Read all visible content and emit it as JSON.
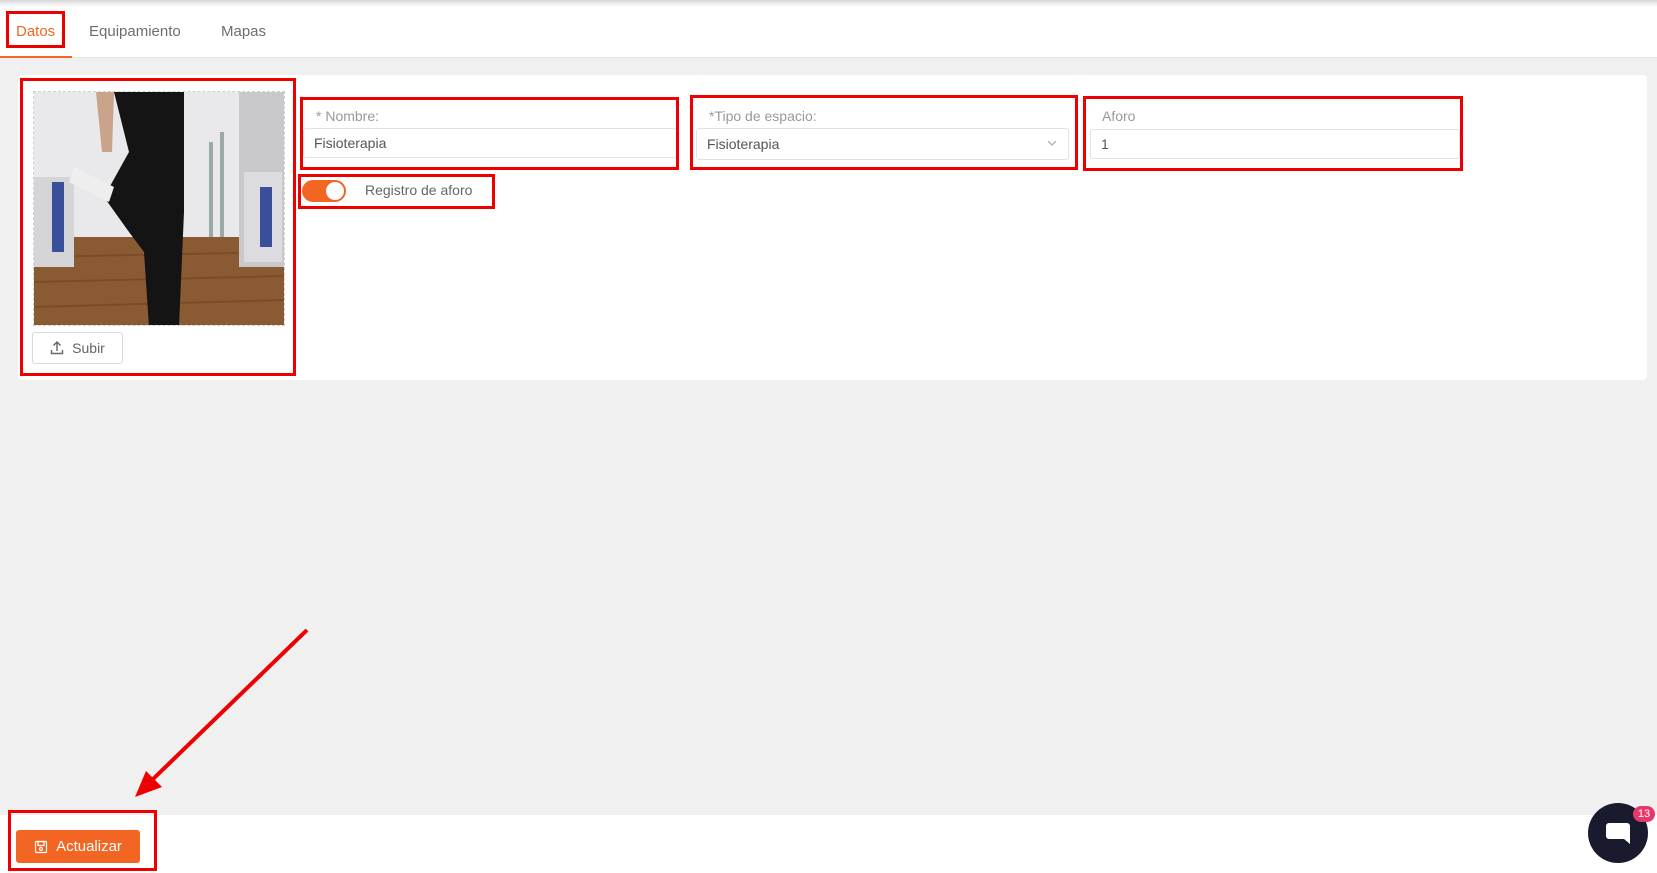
{
  "tabs": [
    {
      "label": "Datos",
      "active": true
    },
    {
      "label": "Equipamiento",
      "active": false
    },
    {
      "label": "Mapas",
      "active": false
    }
  ],
  "photo": {
    "alt": "",
    "upload_label": "Subir",
    "upload_icon": "upload-icon"
  },
  "form": {
    "nombre": {
      "label": "* Nombre:",
      "value": "Fisioterapia"
    },
    "tipo_espacio": {
      "label": "*Tipo de espacio:",
      "value": "Fisioterapia"
    },
    "aforo": {
      "label": "Aforo",
      "value": "1"
    },
    "registro_aforo": {
      "label": "Registro de aforo",
      "enabled": true
    }
  },
  "footer": {
    "update_label": "Actualizar",
    "update_icon": "save-icon"
  },
  "chat": {
    "badge_count": "13"
  },
  "colors": {
    "accent": "#f26522",
    "highlight": "#ee0000",
    "chat": "#1a1a2e",
    "badge": "#e6396b"
  }
}
